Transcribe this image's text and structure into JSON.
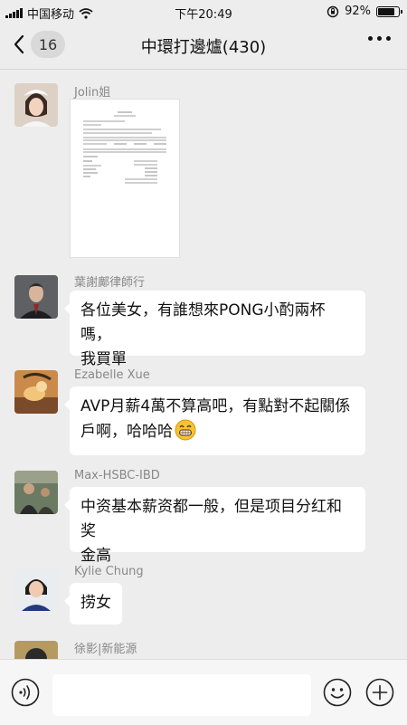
{
  "status_bar": {
    "carrier": "中国移动",
    "time": "下午20:49",
    "battery": "92%",
    "battery_level": 0.92
  },
  "header": {
    "back_count": "16",
    "title": "中環打邊爐(430)"
  },
  "messages": [
    {
      "sender": "Jolin姐",
      "type": "image",
      "image_desc": "document-thumbnail"
    },
    {
      "sender": "葉謝鄺律師行",
      "lines": [
        "各位美女，有誰想來PONG小酌兩杯嗎，",
        "我買單"
      ]
    },
    {
      "sender": "Ezabelle Xue",
      "lines": [
        "AVP月薪4萬不算高吧，有點對不起關係",
        "戶啊，哈哈哈"
      ],
      "emoji": "grin-emoji"
    },
    {
      "sender": "Max-HSBC-IBD",
      "lines": [
        "中资基本薪资都一般，但是项目分红和奖",
        "金高"
      ]
    },
    {
      "sender": "Kylie Chung",
      "lines": [
        "捞女"
      ]
    },
    {
      "sender": "徐影|新能源",
      "type": "partial"
    }
  ],
  "input_bar": {
    "voice_icon": "voice-icon",
    "emoji_icon": "emoji-icon",
    "add_icon": "plus-icon",
    "placeholder": ""
  }
}
